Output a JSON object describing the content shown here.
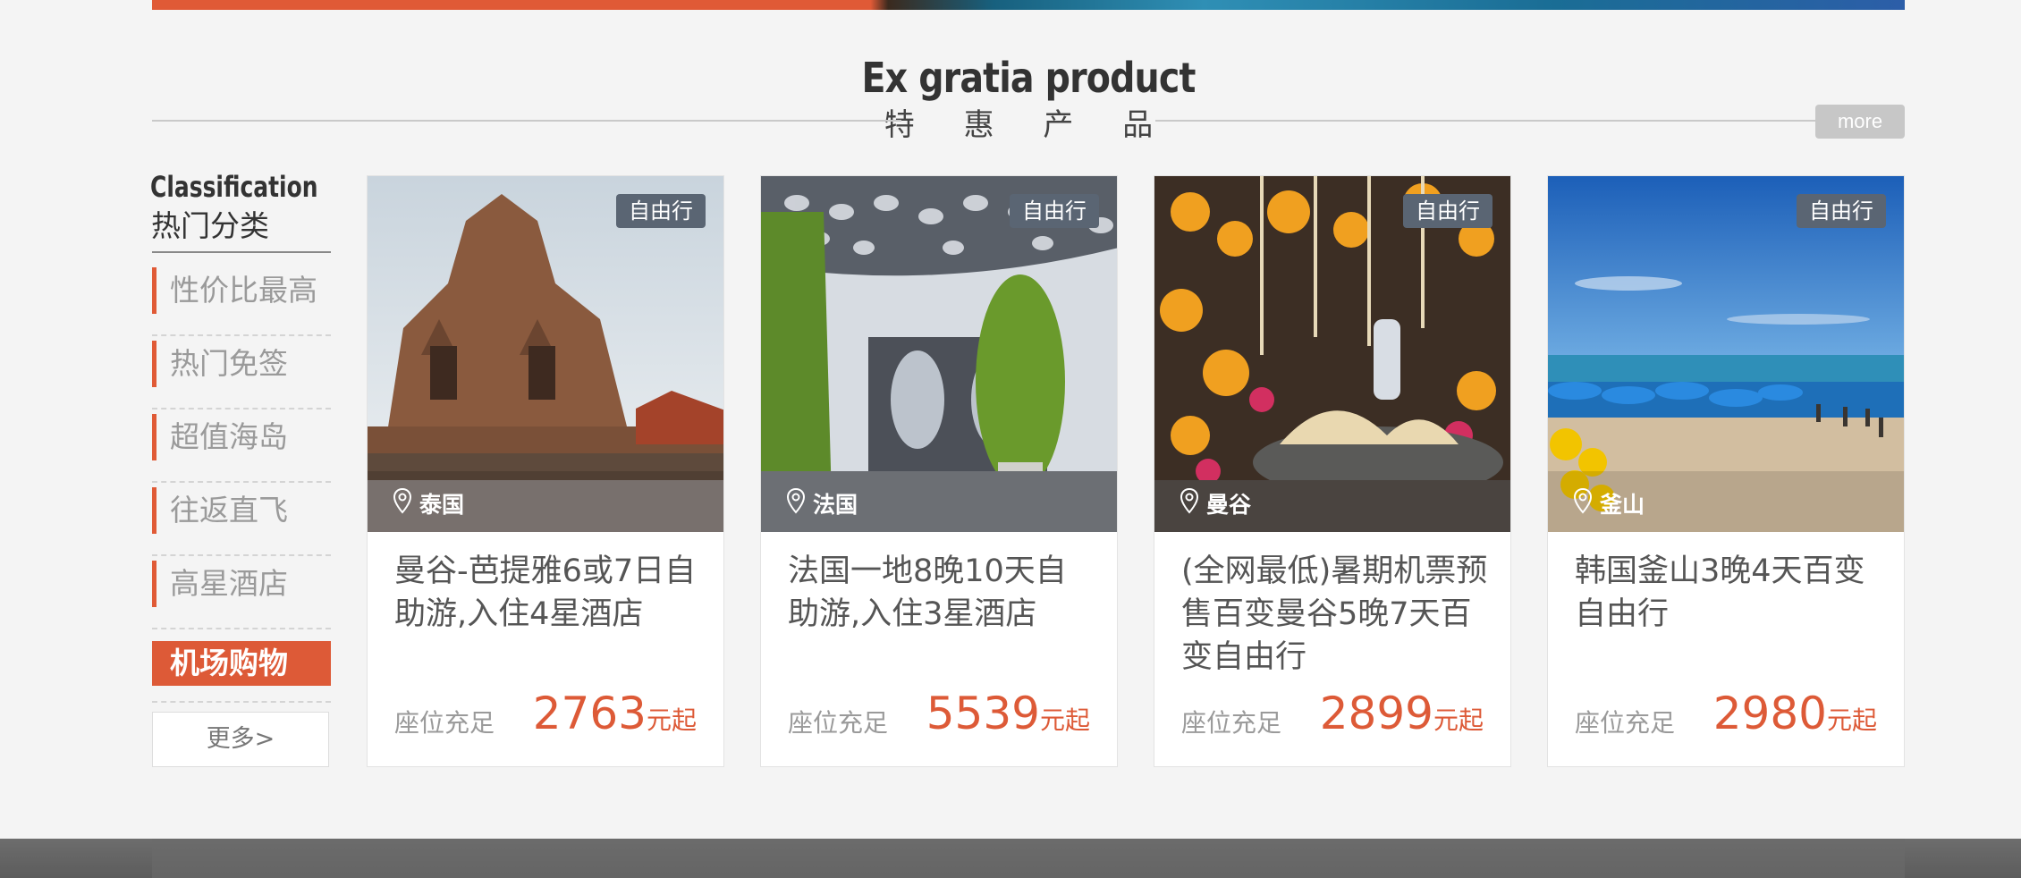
{
  "section": {
    "title_en": "Ex gratia product",
    "title_cn": "特 惠 产 品",
    "more_label": "more"
  },
  "sidebar": {
    "heading_en": "Classification",
    "heading_cn": "热门分类",
    "items": [
      {
        "label": "性价比最高",
        "active": false
      },
      {
        "label": "热门免签",
        "active": false
      },
      {
        "label": "超值海岛",
        "active": false
      },
      {
        "label": "往返直飞",
        "active": false
      },
      {
        "label": "高星酒店",
        "active": false
      },
      {
        "label": "机场购物",
        "active": true
      }
    ],
    "more_label": "更多>"
  },
  "cards": [
    {
      "tag": "自由行",
      "location": "泰国",
      "title": "曼谷-芭提雅6或7日自助游,入住4星酒店",
      "seat_status": "座位充足",
      "price": "2763",
      "price_unit": "元起",
      "image": "temple"
    },
    {
      "tag": "自由行",
      "location": "法国",
      "title": "法国一地8晚10天自助游,入住3星酒店",
      "seat_status": "座位充足",
      "price": "5539",
      "price_unit": "元起",
      "image": "pavilion"
    },
    {
      "tag": "自由行",
      "location": "曼谷",
      "title": "(全网最低)暑期机票预售百变曼谷5晚7天百变自由行",
      "seat_status": "座位充足",
      "price": "2899",
      "price_unit": "元起",
      "image": "flowers"
    },
    {
      "tag": "自由行",
      "location": "釜山",
      "title": "韩国釜山3晚4天百变自由行",
      "seat_status": "座位充足",
      "price": "2980",
      "price_unit": "元起",
      "image": "beach"
    }
  ],
  "colors": {
    "accent": "#dd5a37",
    "tag_bg": "#5a6573",
    "muted_text": "#9a9a9a"
  },
  "icons": {
    "location": "map-pin-icon"
  }
}
